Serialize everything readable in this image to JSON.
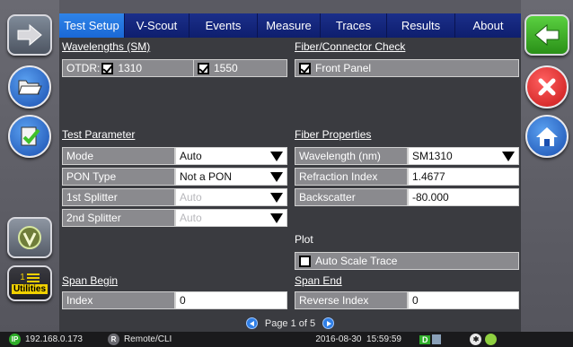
{
  "tabs": [
    {
      "label": "Test Setup",
      "active": true
    },
    {
      "label": "V-Scout",
      "active": false
    },
    {
      "label": "Events",
      "active": false
    },
    {
      "label": "Measure",
      "active": false
    },
    {
      "label": "Traces",
      "active": false
    },
    {
      "label": "Results",
      "active": false
    },
    {
      "label": "About",
      "active": false
    }
  ],
  "left_panel": {
    "utilities_label": "Utilities",
    "utilities_badge": "1"
  },
  "wavelengths": {
    "title": "Wavelengths (SM)",
    "otdr_label": "OTDR:",
    "w1310": {
      "label": "1310",
      "checked": true
    },
    "w1550": {
      "label": "1550",
      "checked": true
    }
  },
  "fiber_check": {
    "title": "Fiber/Connector Check",
    "front_panel": {
      "label": "Front Panel",
      "checked": true
    }
  },
  "test_parameter": {
    "title": "Test Parameter",
    "mode": {
      "label": "Mode",
      "value": "Auto"
    },
    "pon_type": {
      "label": "PON Type",
      "value": "Not a PON"
    },
    "splitter1": {
      "label": "1st Splitter",
      "value": "Auto"
    },
    "splitter2": {
      "label": "2nd Splitter",
      "value": "Auto"
    }
  },
  "fiber_properties": {
    "title": "Fiber Properties",
    "wavelength": {
      "label": "Wavelength (nm)",
      "value": "SM1310"
    },
    "refraction": {
      "label": "Refraction Index",
      "value": "1.4677"
    },
    "backscatter": {
      "label": "Backscatter",
      "value": "-80.000"
    }
  },
  "plot": {
    "title": "Plot",
    "auto_scale": {
      "label": "Auto Scale Trace",
      "checked": false
    }
  },
  "span_begin": {
    "title": "Span Begin",
    "index": {
      "label": "Index",
      "value": "0"
    }
  },
  "span_end": {
    "title": "Span End",
    "reverse_index": {
      "label": "Reverse Index",
      "value": "0"
    }
  },
  "pager": {
    "text": "Page 1 of 5"
  },
  "status": {
    "ip_badge": "IP",
    "ip": "192.168.0.173",
    "remote_badge": "R",
    "remote": "Remote/CLI",
    "datetime": "2016-08-30  15:59:59",
    "d_badge": "D"
  },
  "colors": {
    "tab_active": "#2f84e8",
    "tab_inactive": "#13247a",
    "close_red": "#e0282a",
    "back_green": "#3fc02a"
  }
}
